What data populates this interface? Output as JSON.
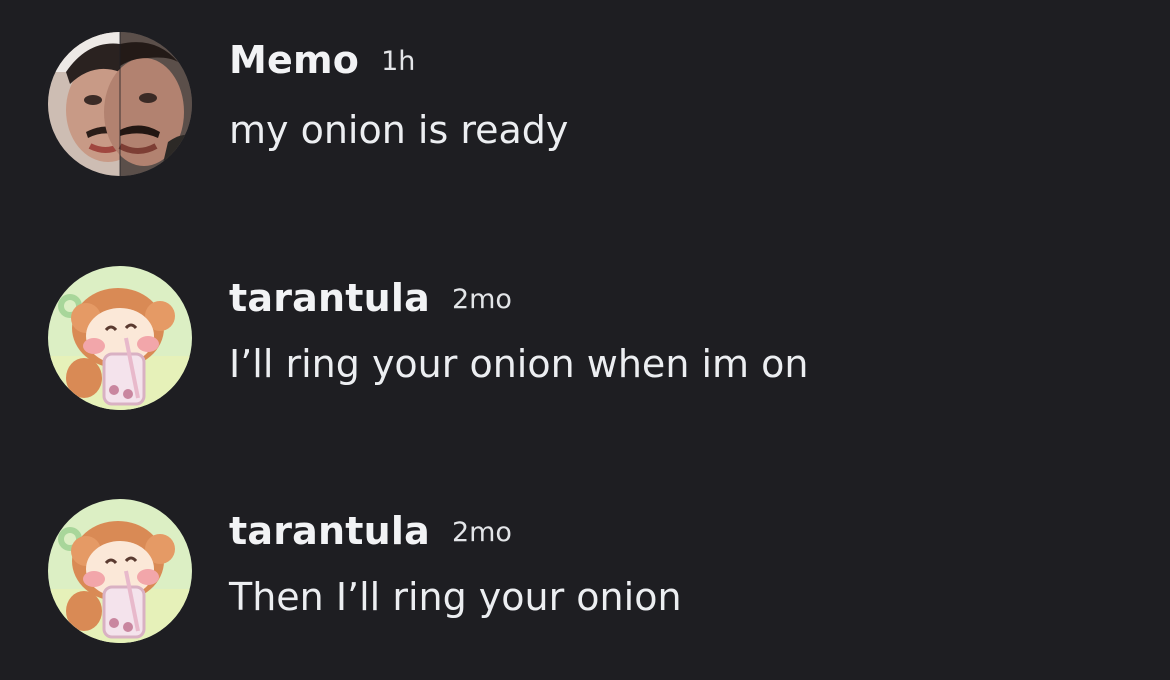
{
  "messages": [
    {
      "author": "Memo",
      "timestamp": "1h",
      "content": "my onion is ready",
      "avatar_icon": "memo-face-avatar"
    },
    {
      "author": "tarantula",
      "timestamp": "2mo",
      "content": "I’ll ring your onion when im on",
      "avatar_icon": "monkey-boba-avatar"
    },
    {
      "author": "tarantula",
      "timestamp": "2mo",
      "content": "Then I’ll ring your onion",
      "avatar_icon": "monkey-boba-avatar"
    }
  ],
  "colors": {
    "background": "#1e1e22",
    "author": "#f2f3f5",
    "text": "#eceef1"
  }
}
